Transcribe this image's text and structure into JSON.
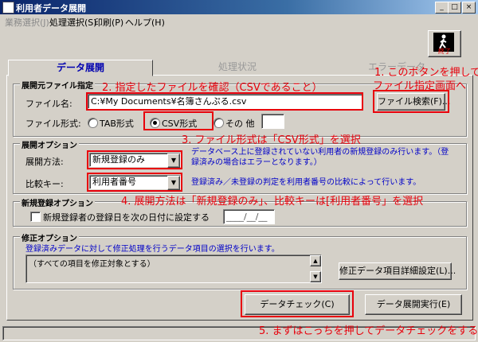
{
  "window": {
    "title": "利用者データ展開"
  },
  "menu": [
    "業務選択(J)",
    "処理選択(S)",
    "印刷(P)",
    "ヘルプ(H)"
  ],
  "exit": {
    "label": "終了"
  },
  "tabs": [
    "データ展開",
    "処理状況",
    "エラーデータ"
  ],
  "source": {
    "title": "展開元ファイル指定",
    "file_label": "ファイル名:",
    "file_value": "C:¥My Documents¥名簿さんぷる.csv",
    "browse_label": "ファイル検索(F)...",
    "format_label": "ファイル形式:",
    "formats": [
      "TAB形式",
      "CSV形式",
      "その 他"
    ],
    "selected_format": "CSV形式",
    "other_value": ""
  },
  "options": {
    "title": "展開オプション",
    "method_label": "展開方法:",
    "method_value": "新規登録のみ",
    "method_note": "データベース上に登録されていない利用者の新規登録のみ行います。（登録済みの場合はエラーとなります。）",
    "key_label": "比較キー:",
    "key_value": "利用者番号",
    "key_note": "登録済み／未登録の判定を利用者番号の比較によって行います。"
  },
  "new_reg": {
    "title": "新規登録オプション",
    "checkbox_label": "新規登録者の登録日を次の日付に設定する",
    "checked": false,
    "date_placeholder": "____/__/__"
  },
  "modify": {
    "title": "修正オプション",
    "note": "登録済みデータに対して修正処理を行うデータ項目の選択を行います。",
    "list_text": "（すべての項目を修正対象とする）",
    "detail_button": "修正データ項目詳細設定(L)..."
  },
  "actions": {
    "check_button": "データチェック(C)",
    "run_button": "データ展開実行(E)"
  },
  "annotations": {
    "a1_line1": "1. このボタンを押して、",
    "a1_line2": "ファイル指定画面へ",
    "a2": "2. 指定したファイルを確認（CSVであること）",
    "a3": "3. ファイル形式は「CSV形式」を選択",
    "a4": "4. 展開方法は「新規登録のみ」、比較キーは[利用者番号」を選択",
    "a5": "5. まずはこっちを押してデータチェックをする"
  },
  "colors": {
    "annotation": "#e8000b",
    "note": "#0000c8",
    "titlebar": "#0a246a"
  }
}
